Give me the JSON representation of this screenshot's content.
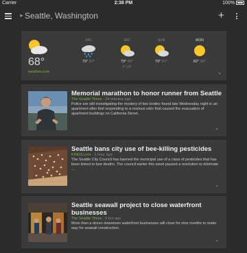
{
  "status": {
    "carrier": "Carrier",
    "time": "2:38 PM",
    "battery": "100%"
  },
  "header": {
    "location": "Seattle, Washington",
    "add_icon": "plus-icon",
    "more_icon": "more-vert-icon",
    "menu_icon": "menu-icon"
  },
  "weather": {
    "current_temp": "68°",
    "source": "weather.com",
    "days": [
      {
        "name": "",
        "icon": "sun-cloud",
        "hi": "",
        "lo": "",
        "precip": ""
      },
      {
        "name": "FRI",
        "icon": "rain-cloud",
        "hi": "79°",
        "lo": "57°",
        "precip": ""
      },
      {
        "name": "SAT",
        "icon": "sun-cloud",
        "hi": "79°",
        "lo": "56°",
        "precip": "1° | 0°"
      },
      {
        "name": "SUN",
        "icon": "sun-cloud",
        "hi": "79°",
        "lo": "57°",
        "precip": ""
      },
      {
        "name": "MON",
        "icon": "sun",
        "hi": "82°",
        "lo": "59°",
        "precip": ""
      }
    ]
  },
  "stories": [
    {
      "headline": "Memorial marathon to honor runner from Seattle",
      "source": "The Seattle Times",
      "ago": " · 24 minutes ago",
      "body": "Police are still investigating the mystery of two bodies found late Wednesday night in an apartment after first responding to a noxious odor that caused the evacuation of apartment buildings on California Street."
    },
    {
      "headline": "Seattle bans city use of bee-killing pesticides",
      "source": "KING5.com",
      "ago": " · 1 hour ago",
      "body": "The Seattle City Council has banned the municipal use of a class of pesticides that has been linked to bee deaths. The council earlier this week passed a resolution to eliminate ..."
    },
    {
      "headline": "Seattle seawall project to close waterfront businesses",
      "source": "The Seattle Times",
      "ago": " · 5 hrs ago",
      "body": "More than a dozen downtown waterfront businesses will close for nine months to make way for seawall construction."
    }
  ]
}
